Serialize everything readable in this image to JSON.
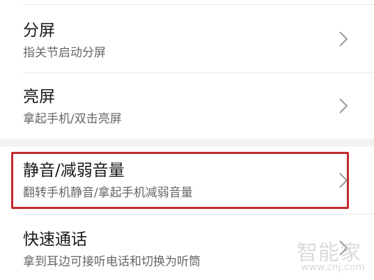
{
  "settings": {
    "items": [
      {
        "title": "分屏",
        "subtitle": "指关节启动分屏"
      },
      {
        "title": "亮屏",
        "subtitle": "拿起手机/双击亮屏"
      },
      {
        "title": "静音/减弱音量",
        "subtitle": "翻转手机静音/拿起手机减弱音量"
      },
      {
        "title": "快速通话",
        "subtitle": "拿到耳边可接听电话和切换为听筒"
      }
    ],
    "chevron_icon": "chevron-right-icon"
  },
  "colors": {
    "highlight": "#c0282b",
    "section_gap": "#f3f3f3"
  },
  "watermark": {
    "text": "智能家",
    "url": "www.znj.com"
  }
}
